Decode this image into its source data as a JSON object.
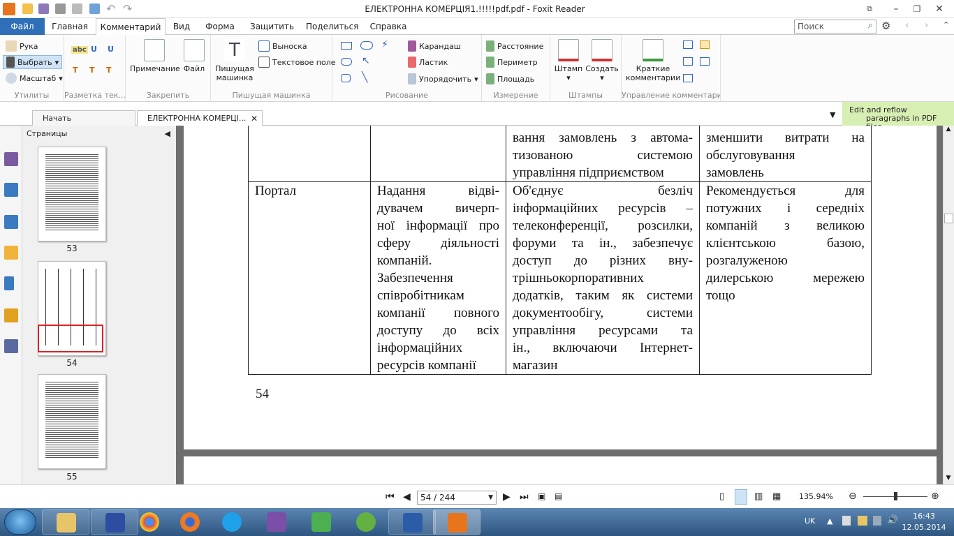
{
  "window": {
    "title": "ЕЛЕКТРОННА КОМЕРЦІЯ1.!!!!!pdf.pdf - Foxit Reader"
  },
  "menu": {
    "file": "Файл",
    "items": [
      "Главная",
      "Комментарий",
      "Вид",
      "Форма",
      "Защитить",
      "Поделиться",
      "Справка"
    ]
  },
  "search": {
    "placeholder": "Поиск"
  },
  "ribbon": {
    "utilities": {
      "label": "Утилиты",
      "hand": "Рука",
      "select": "Выбрать",
      "zoom": "Масштаб"
    },
    "markup": {
      "label": "Разметка тек...",
      "abc": "abc"
    },
    "pin": {
      "label": "Закрепить",
      "note": "Примечание",
      "file": "Файл"
    },
    "typewriter": {
      "label": "Пишущая машинка",
      "big": "Пишущая машинка",
      "callout": "Выноска",
      "textbox": "Текстовое поле"
    },
    "drawing": {
      "label": "Рисование",
      "pencil": "Карандаш",
      "eraser": "Ластик",
      "arrange": "Упорядочить"
    },
    "measure": {
      "label": "Измерение",
      "distance": "Расстояние",
      "perimeter": "Периметр",
      "area": "Площадь"
    },
    "stamps": {
      "label": "Штампы",
      "stamp": "Штамп",
      "create": "Создать"
    },
    "manage": {
      "label": "Управление комментари...",
      "summary": "Краткие комментарии"
    }
  },
  "tabs": {
    "start": "Начать",
    "doc": "ЕЛЕКТРОННА КОМЕРЦІ..."
  },
  "banner": {
    "line1": "Edit and reflow",
    "line2": "paragraphs in PDF files"
  },
  "pages_panel": {
    "title": "Страницы",
    "thumbs": [
      "53",
      "54",
      "55"
    ]
  },
  "document": {
    "top_row": {
      "c3": [
        "вання замовлень з автома-",
        "тизованою системою",
        "управління підприємством"
      ],
      "c4": [
        "зменшити витрати на",
        "обслуговування",
        "замовлень"
      ]
    },
    "row": {
      "c1": "Портал",
      "c2": [
        "Надання відві-",
        "дувачем вичерп-",
        "ної інформації про",
        "сферу діяльності",
        "компаній.",
        "Забезпечення",
        "співробітникам",
        "компанії повного",
        "доступу до всіх",
        "інформаційних",
        "ресурсів компанії"
      ],
      "c3": [
        "Об'єднує безліч",
        "інформаційних ресурсів –",
        "телеконференції, розсилки,",
        "форуми та ін., забезпечує",
        "доступ до різних вну-",
        "трішньокорпоративних",
        "додатків, таким як системи",
        "документообігу, системи",
        "управління ресурсами та",
        "ін., включаючи Інтернет-",
        "магазин"
      ],
      "c4": [
        "Рекомендується для",
        "потужних і середніх",
        "компаній з великою",
        "клієнтською базою,",
        "розгалуженою",
        "дилерською мережею",
        "тощо"
      ]
    },
    "page_number": "54"
  },
  "status": {
    "page": "54 / 244",
    "zoom": "135.94%"
  },
  "tray": {
    "lang": "UK",
    "time": "16:43",
    "date": "12.05.2014"
  }
}
